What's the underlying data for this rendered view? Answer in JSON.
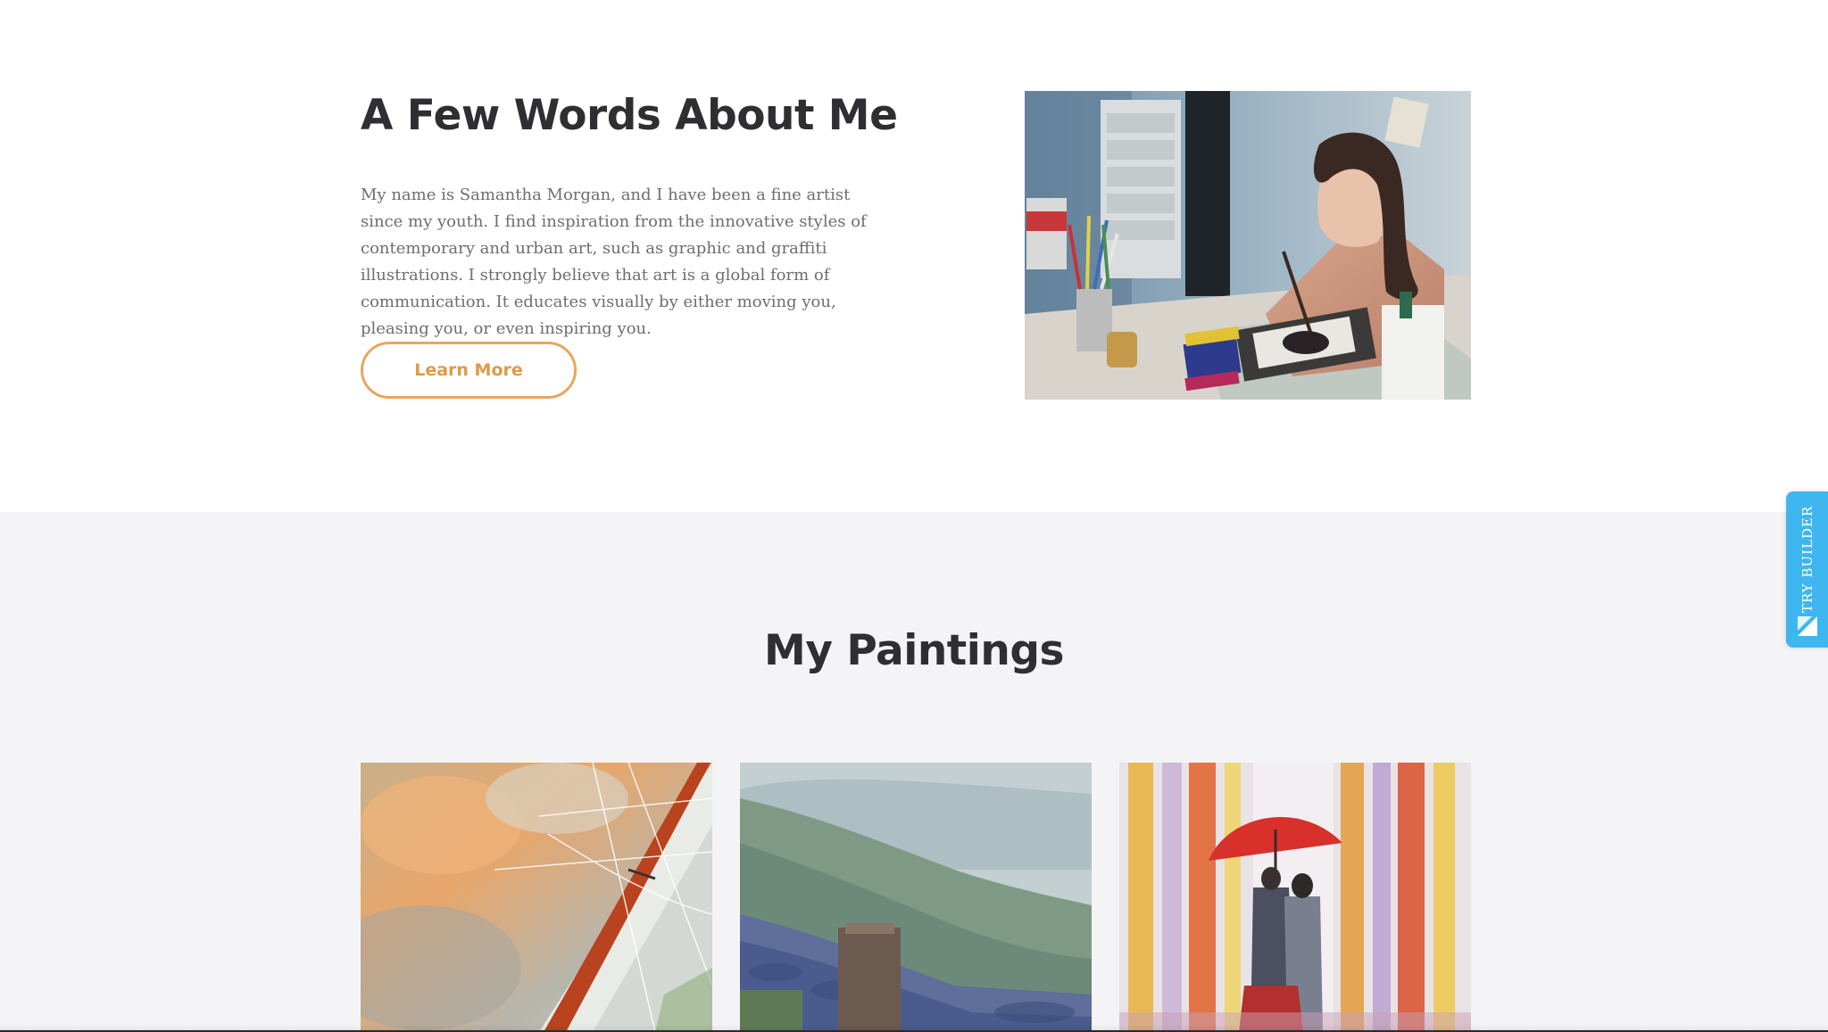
{
  "about": {
    "title": "A Few Words About Me",
    "text": "My name is Samantha Morgan, and I have been a fine artist since my youth. I find inspiration from the innovative styles of contemporary and urban art, such as graphic and graffiti illustrations. I strongly believe that art is a global form of communication. It educates visually by either moving you, pleasing you, or even inspiring you.",
    "button_label": "Learn More"
  },
  "paintings": {
    "title": "My Paintings",
    "items": [
      {
        "subject": "sailboat"
      },
      {
        "subject": "landscape"
      },
      {
        "subject": "umbrella-couple"
      }
    ]
  },
  "side_widget": {
    "label": "TRY BUILDER",
    "icon": "builder-icon"
  },
  "colors": {
    "accent": "#e7a760",
    "widget": "#3fb6f0",
    "heading": "#2f2f33",
    "body_text": "#6d6d73",
    "section_bg": "#f4f4f6"
  }
}
